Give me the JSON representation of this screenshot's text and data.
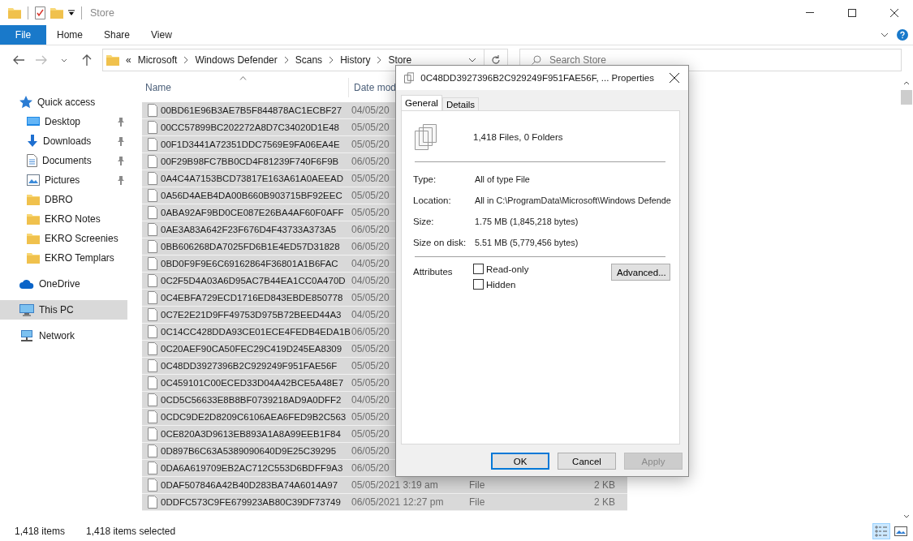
{
  "window": {
    "title": "Store"
  },
  "ribbon": {
    "tabs": [
      {
        "label": "File",
        "selected": true
      },
      {
        "label": "Home",
        "selected": false
      },
      {
        "label": "Share",
        "selected": false
      },
      {
        "label": "View",
        "selected": false
      }
    ]
  },
  "address": {
    "overflow": "«",
    "crumbs": [
      "Microsoft",
      "Windows Defender",
      "Scans",
      "History",
      "Store"
    ]
  },
  "search": {
    "placeholder": "Search Store"
  },
  "sidebar": {
    "sections": [
      {
        "label": "Quick access",
        "kind": "star",
        "selected": false,
        "children": [
          {
            "label": "Desktop",
            "kind": "desktop",
            "pinned": true,
            "selected": false
          },
          {
            "label": "Downloads",
            "kind": "download",
            "pinned": true,
            "selected": false
          },
          {
            "label": "Documents",
            "kind": "document",
            "pinned": true,
            "selected": false
          },
          {
            "label": "Pictures",
            "kind": "picture",
            "pinned": true,
            "selected": false
          },
          {
            "label": "DBRO",
            "kind": "folder",
            "pinned": false,
            "selected": false
          },
          {
            "label": "EKRO Notes",
            "kind": "folder",
            "pinned": false,
            "selected": false
          },
          {
            "label": "EKRO Screenies",
            "kind": "folder",
            "pinned": false,
            "selected": false
          },
          {
            "label": "EKRO Templars",
            "kind": "folder",
            "pinned": false,
            "selected": false
          }
        ]
      },
      {
        "label": "OneDrive",
        "kind": "cloud",
        "selected": false
      },
      {
        "label": "This PC",
        "kind": "pc",
        "selected": true
      },
      {
        "label": "Network",
        "kind": "network",
        "selected": false
      }
    ]
  },
  "table": {
    "columns": [
      "Name",
      "Date mod"
    ],
    "rows": [
      {
        "name": "00BD61E96B3AE7B5F844878AC1ECBF27",
        "date": "04/05/20",
        "selected": true
      },
      {
        "name": "00CC57899BC202272A8D7C34020D1E48",
        "date": "05/05/20",
        "selected": true
      },
      {
        "name": "00F1D3441A72351DDC7569E9FA06EA4E",
        "date": "05/05/20",
        "selected": true
      },
      {
        "name": "00F29B98FC7BB0CD4F81239F740F6F9B",
        "date": "06/05/20",
        "selected": true
      },
      {
        "name": "0A4C4A7153BCD73817E163A61A0AEEAD",
        "date": "05/05/20",
        "selected": true
      },
      {
        "name": "0A56D4AEB4DA00B660B903715BF92EEC",
        "date": "05/05/20",
        "selected": true
      },
      {
        "name": "0ABA92AF9BD0CE087E26BA4AF60F0AFF",
        "date": "05/05/20",
        "selected": true
      },
      {
        "name": "0AE3A83A642F23F676D4F43733A373A5",
        "date": "06/05/20",
        "selected": true
      },
      {
        "name": "0BB606268DA7025FD6B1E4ED57D31828",
        "date": "06/05/20",
        "selected": true
      },
      {
        "name": "0BD0F9F9E6C69162864F36801A1B6FAC",
        "date": "04/05/20",
        "selected": true
      },
      {
        "name": "0C2F5D4A03A6D95AC7B44EA1CC0A470D",
        "date": "04/05/20",
        "selected": true
      },
      {
        "name": "0C4EBFA729ECD1716ED843EBDE850778",
        "date": "05/05/20",
        "selected": true
      },
      {
        "name": "0C7E2E21D9FF49753D975B72BEED44A3",
        "date": "04/05/20",
        "selected": true
      },
      {
        "name": "0C14CC428DDA93CE01ECE4FEDB4EDA1B",
        "date": "06/05/20",
        "selected": true
      },
      {
        "name": "0C20AEF90CA50FEC29C419D245EA8309",
        "date": "05/05/20",
        "selected": true
      },
      {
        "name": "0C48DD3927396B2C929249F951FAE56F",
        "date": "05/05/20",
        "selected": true
      },
      {
        "name": "0C459101C00ECED33D04A42BCE5A48E7",
        "date": "05/05/20",
        "selected": true
      },
      {
        "name": "0CD5C56633E8B8BF0739218AD9A0DFF2",
        "date": "04/05/20",
        "selected": true
      },
      {
        "name": "0CDC9DE2D8209C6106AEA6FED9B2C563",
        "date": "05/05/20",
        "selected": true
      },
      {
        "name": "0CE820A3D9613EB893A1A8A99EEB1F84",
        "date": "05/05/20",
        "selected": true
      },
      {
        "name": "0D897B6C63A5389090640D9E25C39295",
        "date": "06/05/20",
        "selected": true
      },
      {
        "name": "0DA6A619709EB2AC712C553D6BDFF9A3",
        "date": "06/05/20",
        "selected": true
      },
      {
        "name": "0DAF507846A42B40D283BA74A6014A97",
        "date": "05/05/2021 3:19 am",
        "type": "File",
        "size": "2 KB",
        "selected": true
      },
      {
        "name": "0DDFC573C9FE679923AB80C39DF73749",
        "date": "06/05/2021 12:27 pm",
        "type": "File",
        "size": "2 KB",
        "selected": true
      }
    ]
  },
  "status_bar": {
    "count": "1,418 items",
    "selection": "1,418 items selected"
  },
  "dialog": {
    "title": "0C48DD3927396B2C929249F951FAE56F, ... Properties",
    "tabs": [
      {
        "label": "General",
        "selected": true
      },
      {
        "label": "Details",
        "selected": false
      }
    ],
    "summary": "1,418 Files, 0 Folders",
    "properties": [
      {
        "label": "Type:",
        "value": "All of type File"
      },
      {
        "label": "Location:",
        "value": "All in C:\\ProgramData\\Microsoft\\Windows Defende"
      },
      {
        "label": "Size:",
        "value": "1.75 MB (1,845,218 bytes)"
      },
      {
        "label": "Size on disk:",
        "value": "5.51 MB (5,779,456 bytes)"
      }
    ],
    "attributes_label": "Attributes",
    "attributes": [
      {
        "label": "Read-only",
        "checked": false
      },
      {
        "label": "Hidden",
        "checked": false
      }
    ],
    "advanced": "Advanced...",
    "buttons": [
      {
        "label": "OK",
        "focused": true,
        "disabled": false
      },
      {
        "label": "Cancel",
        "focused": false,
        "disabled": false
      },
      {
        "label": "Apply",
        "focused": false,
        "disabled": true
      }
    ]
  }
}
